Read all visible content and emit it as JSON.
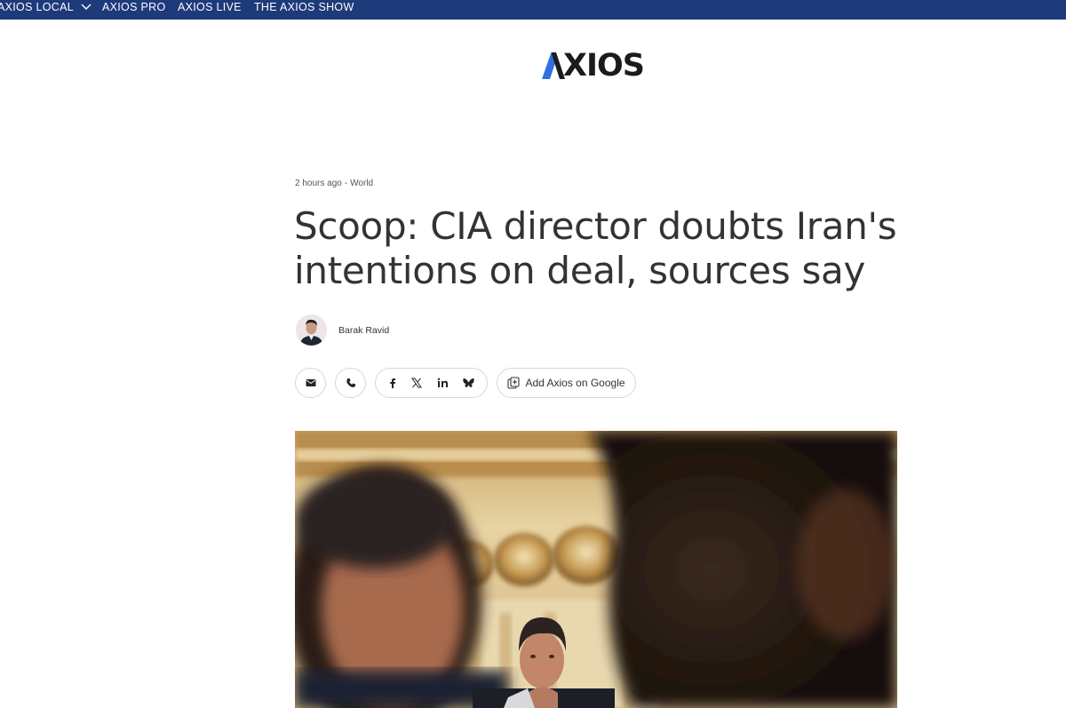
{
  "nav": {
    "items": [
      "AXIOS LOCAL",
      "AXIOS PRO",
      "AXIOS LIVE",
      "THE AXIOS SHOW"
    ],
    "bg_color": "#1d3a7a"
  },
  "logo": {
    "text": "AXIOS",
    "accent_color": "#2f6fe0"
  },
  "article": {
    "time": "2 hours ago",
    "separator": "-",
    "section": "World",
    "headline": "Scoop: CIA director doubts Iran's intentions on deal, sources say",
    "author": "Barak Ravid"
  },
  "share": {
    "icons": [
      "email-icon",
      "phone-icon",
      "facebook-icon",
      "x-icon",
      "linkedin-icon",
      "bluesky-icon"
    ],
    "add_google_label": "Add Axios on Google"
  }
}
